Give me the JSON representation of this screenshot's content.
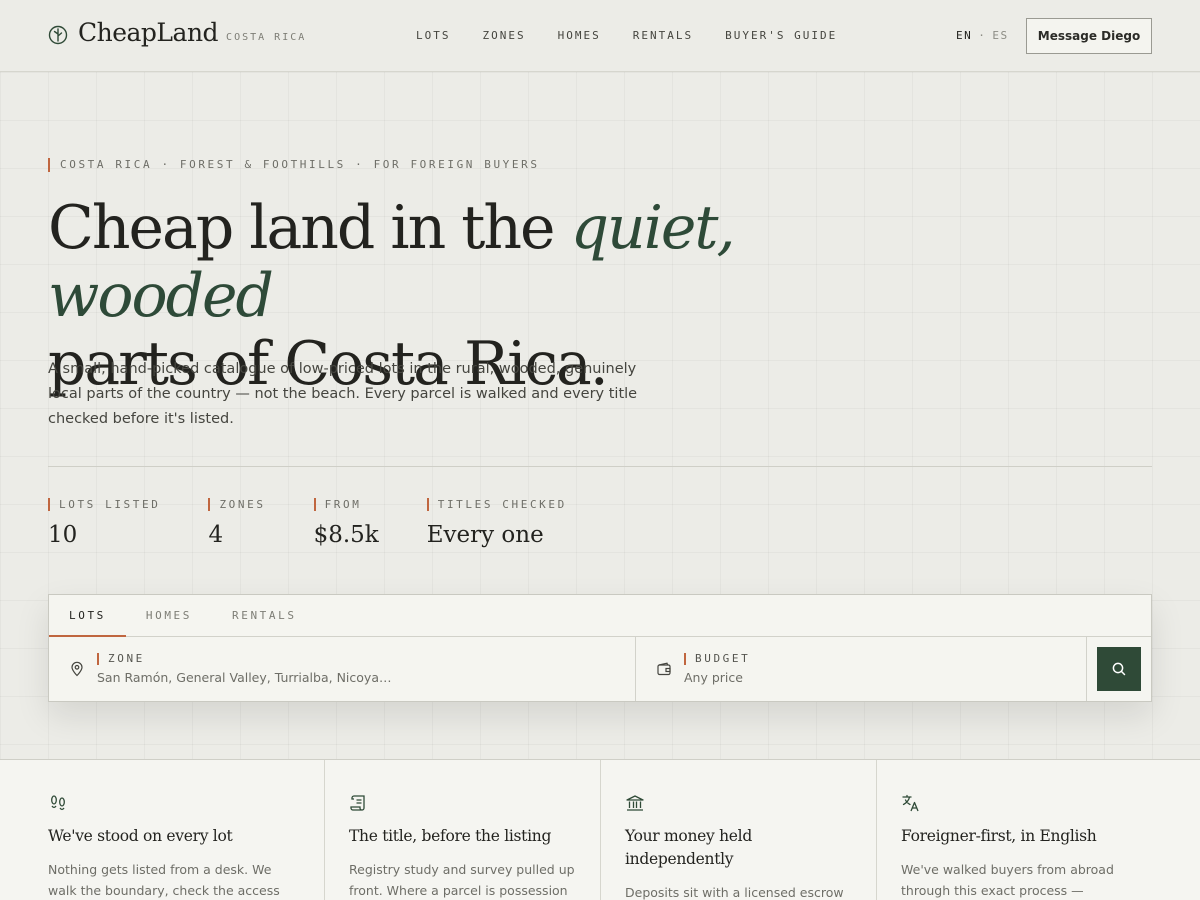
{
  "header": {
    "logo_text": "CheapLand",
    "logo_sub": "COSTA RICA",
    "nav": [
      "LOTS",
      "ZONES",
      "HOMES",
      "RENTALS",
      "BUYER'S GUIDE"
    ],
    "lang_active": "EN",
    "lang_sep": "·",
    "lang_inactive": "ES",
    "message_button": "Message Diego"
  },
  "hero": {
    "eyebrow": "COSTA RICA · FOREST & FOOTHILLS · FOR FOREIGN BUYERS",
    "title_part1": "Cheap land in the ",
    "title_emphasis": "quiet, wooded",
    "title_part2": "parts of Costa Rica.",
    "lead": "A small, hand-picked catalogue of low-priced lots in the rural, wooded, genuinely local parts of the country — not the beach. Every parcel is walked and every title checked before it's listed."
  },
  "stats": [
    {
      "label": "LOTS LISTED",
      "value": "10"
    },
    {
      "label": "ZONES",
      "value": "4"
    },
    {
      "label": "FROM",
      "value": "$8.5k"
    },
    {
      "label": "TITLES CHECKED",
      "value": "Every one"
    }
  ],
  "search": {
    "tabs": [
      "LOTS",
      "HOMES",
      "RENTALS"
    ],
    "active_tab": "LOTS",
    "zone_label": "ZONE",
    "zone_value": "San Ramón, General Valley, Turrialba, Nicoya…",
    "budget_label": "BUDGET",
    "budget_value": "Any price",
    "search_icon": "search-icon"
  },
  "features": [
    {
      "icon": "footprints-icon",
      "title": "We've stood on every lot",
      "text": "Nothing gets listed from a desk. We walk the boundary, check the access road in"
    },
    {
      "icon": "scroll-icon",
      "title": "The title, before the listing",
      "text": "Registry study and survey pulled up front. Where a parcel is possession"
    },
    {
      "icon": "bank-icon",
      "title": "Your money held independently",
      "text": "Deposits sit with a licensed escrow"
    },
    {
      "icon": "translate-icon",
      "title": "Foreigner-first, in English",
      "text": "We've walked buyers from abroad through this exact process —"
    }
  ],
  "colors": {
    "accent": "#c0663f",
    "brand_green": "#2f4a37",
    "background": "#ecece7"
  }
}
